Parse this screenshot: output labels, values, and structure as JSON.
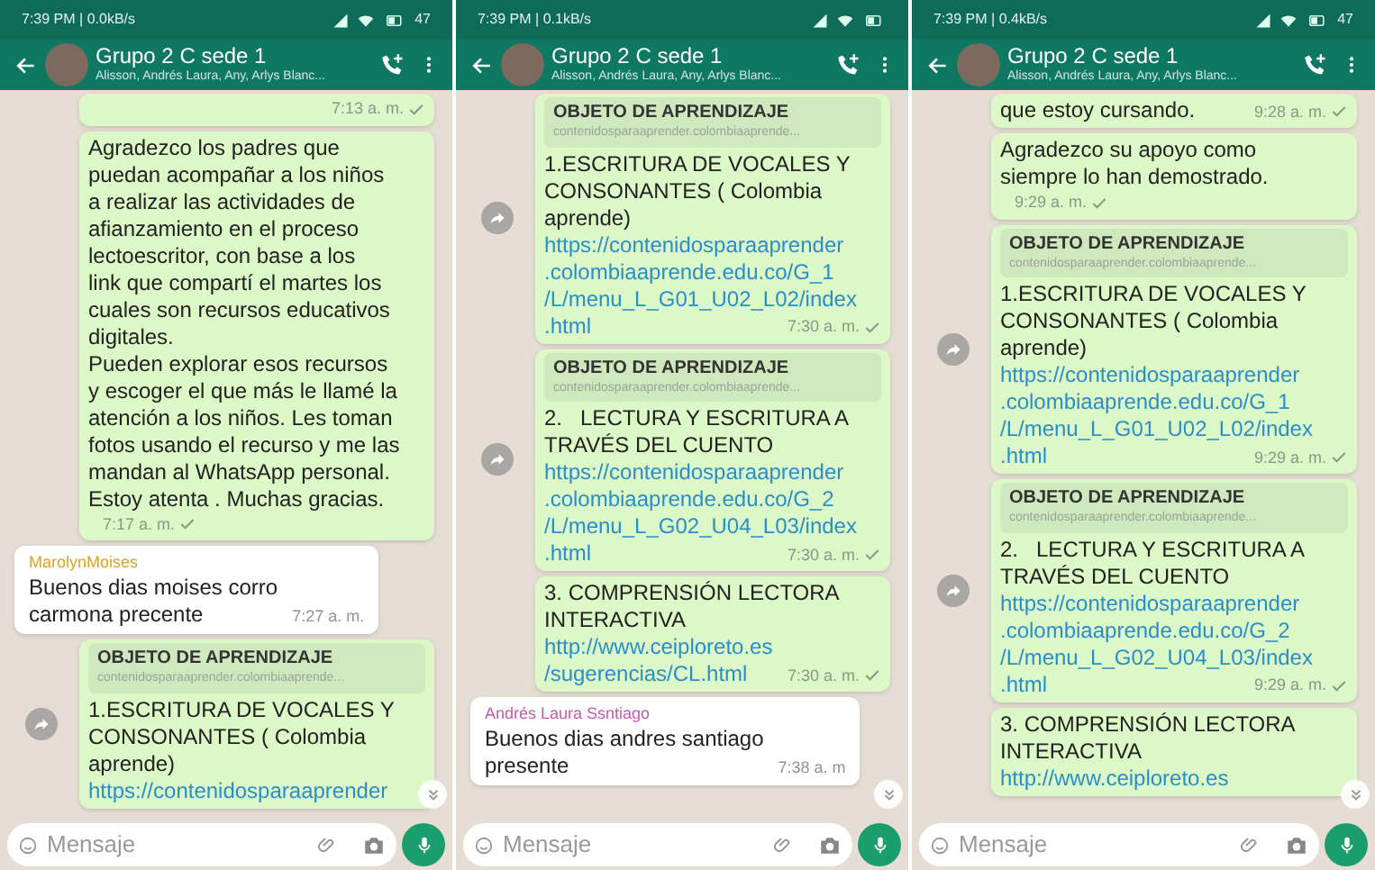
{
  "panels": [
    {
      "status": {
        "text": "7:39 PM | 0.0kB/s",
        "battery": "47"
      },
      "header": {
        "title": "Grupo 2 C sede 1",
        "subtitle": "Alisson, Andrés Laura, Any, Arlys Blanc..."
      },
      "messages": [
        {
          "kind": "out",
          "time": "7:13 a. m."
        },
        {
          "kind": "out",
          "text": "Agradezco los padres que\npuedan acompañar a los niños\na realizar las actividades de\nafianzamiento en el proceso\nlectoescritor, con base a los\nlink que compartí el martes los\ncuales son recursos educativos\ndigitales.\nPueden explorar esos recursos\ny escoger el que más le llamé la\natención a los niños. Les toman\nfotos usando el recurso y me las\nmandan al WhatsApp personal.\nEstoy atenta . Muchas gracias.",
          "time": "7:17 a. m."
        },
        {
          "kind": "in",
          "sender": "MarolynMoises",
          "color": "#d9a429",
          "text": "Buenos dias moises corro\ncarmona precente",
          "time": "7:27 a. m."
        },
        {
          "kind": "link",
          "forward": true,
          "preview_title": "OBJETO DE APRENDIZAJE",
          "preview_domain": "contenidosparaaprender.colombiaaprende...",
          "text": "1.ESCRITURA DE VOCALES Y\nCONSONANTES ( Colombia\naprende)",
          "link": "https://contenidosparaaprender"
        }
      ],
      "input": {
        "placeholder": "Mensaje"
      }
    },
    {
      "status": {
        "text": "7:39 PM | 0.1kB/s"
      },
      "header": {
        "title": "Grupo 2 C sede 1",
        "subtitle": "Alisson, Andrés Laura, Any, Arlys Blanc..."
      },
      "messages": [
        {
          "kind": "link",
          "forward": true,
          "preview_title": "OBJETO DE APRENDIZAJE",
          "preview_domain": "contenidosparaaprender.colombiaaprende...",
          "text": "1.ESCRITURA DE VOCALES Y\nCONSONANTES ( Colombia\naprende)",
          "link": "https://contenidosparaaprender\n.colombiaaprende.edu.co/G_1\n/L/menu_L_G01_U02_L02/index\n.html",
          "time": "7:30 a. m."
        },
        {
          "kind": "link",
          "forward": true,
          "preview_title": "OBJETO DE APRENDIZAJE",
          "preview_domain": "contenidosparaaprender.colombiaaprende...",
          "text": "2.   LECTURA Y ESCRITURA A\nTRAVÉS DEL CUENTO",
          "link": "https://contenidosparaaprender\n.colombiaaprende.edu.co/G_2\n/L/menu_L_G02_U04_L03/index\n.html",
          "time": "7:30 a. m."
        },
        {
          "kind": "link",
          "forward": false,
          "text": "3. COMPRENSIÓN LECTORA\nINTERACTIVA",
          "link": "http://www.ceiploreto.es\n/sugerencias/CL.html",
          "time": "7:30 a. m."
        },
        {
          "kind": "in",
          "sender": "Andrés Laura Ssntiago",
          "color": "#c55aae",
          "text": "Buenos dias andres santiago\npresente",
          "time": "7:38 a. m"
        }
      ],
      "input": {
        "placeholder": "Mensaje"
      }
    },
    {
      "status": {
        "text": "7:39 PM | 0.4kB/s",
        "battery": "47"
      },
      "header": {
        "title": "Grupo 2 C sede 1",
        "subtitle": "Alisson, Andrés Laura, Any, Arlys Blanc..."
      },
      "messages": [
        {
          "kind": "out",
          "text": "que estoy cursando.",
          "time": "9:28 a. m."
        },
        {
          "kind": "out",
          "text": "Agradezco su apoyo como\nsiempre lo han demostrado.",
          "time": "9:29 a. m."
        },
        {
          "kind": "link",
          "forward": true,
          "preview_title": "OBJETO DE APRENDIZAJE",
          "preview_domain": "contenidosparaaprender.colombiaaprende...",
          "text": "1.ESCRITURA DE VOCALES Y\nCONSONANTES ( Colombia\naprende)",
          "link": "https://contenidosparaaprender\n.colombiaaprende.edu.co/G_1\n/L/menu_L_G01_U02_L02/index\n.html",
          "time": "9:29 a. m."
        },
        {
          "kind": "link",
          "forward": true,
          "preview_title": "OBJETO DE APRENDIZAJE",
          "preview_domain": "contenidosparaaprender.colombiaaprende...",
          "text": "2.   LECTURA Y ESCRITURA A\nTRAVÉS DEL CUENTO",
          "link": "https://contenidosparaaprender\n.colombiaaprende.edu.co/G_2\n/L/menu_L_G02_U04_L03/index\n.html",
          "time": "9:29 a. m."
        },
        {
          "kind": "link",
          "forward": false,
          "text": "3. COMPRENSIÓN LECTORA\nINTERACTIVA",
          "link": "http://www.ceiploreto.es"
        }
      ],
      "input": {
        "placeholder": "Mensaje"
      }
    }
  ]
}
